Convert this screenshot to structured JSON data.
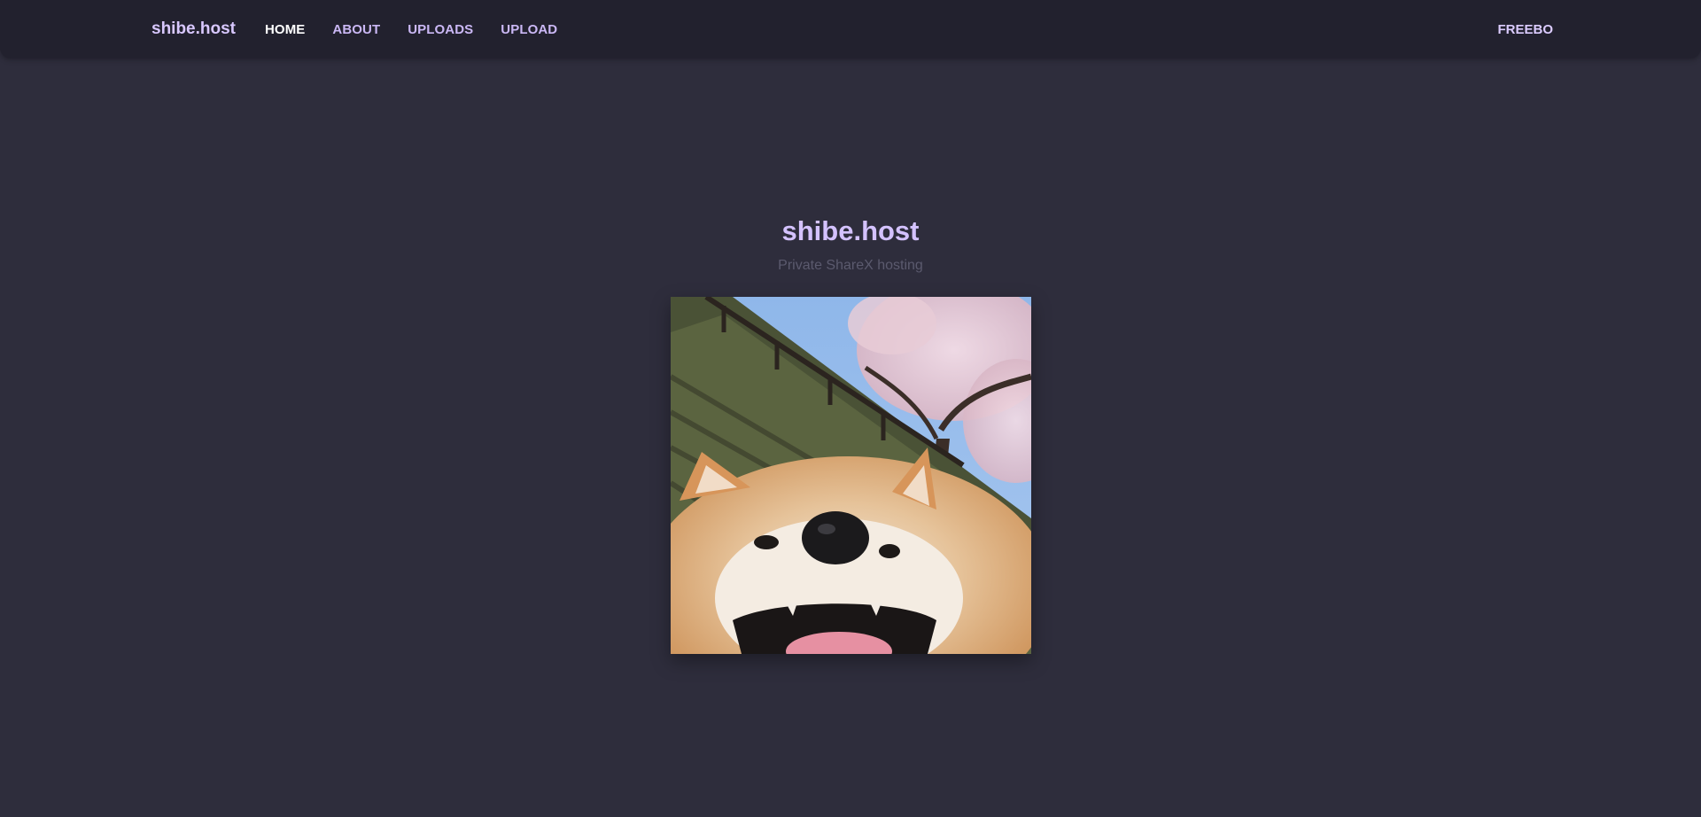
{
  "navbar": {
    "brand": "shibe.host",
    "links": [
      {
        "label": "HOME",
        "active": true
      },
      {
        "label": "ABOUT",
        "active": false
      },
      {
        "label": "UPLOADS",
        "active": false
      },
      {
        "label": "UPLOAD",
        "active": false
      }
    ],
    "user": "FREEBO"
  },
  "hero": {
    "title": "shibe.host",
    "subtitle": "Private ShareX hosting",
    "image_subject": "shiba-inu-photo"
  },
  "colors": {
    "background": "#2e2d3c",
    "navbar": "#22212e",
    "accent": "#d4c2ff",
    "subtitle": "#5b5a6e"
  }
}
